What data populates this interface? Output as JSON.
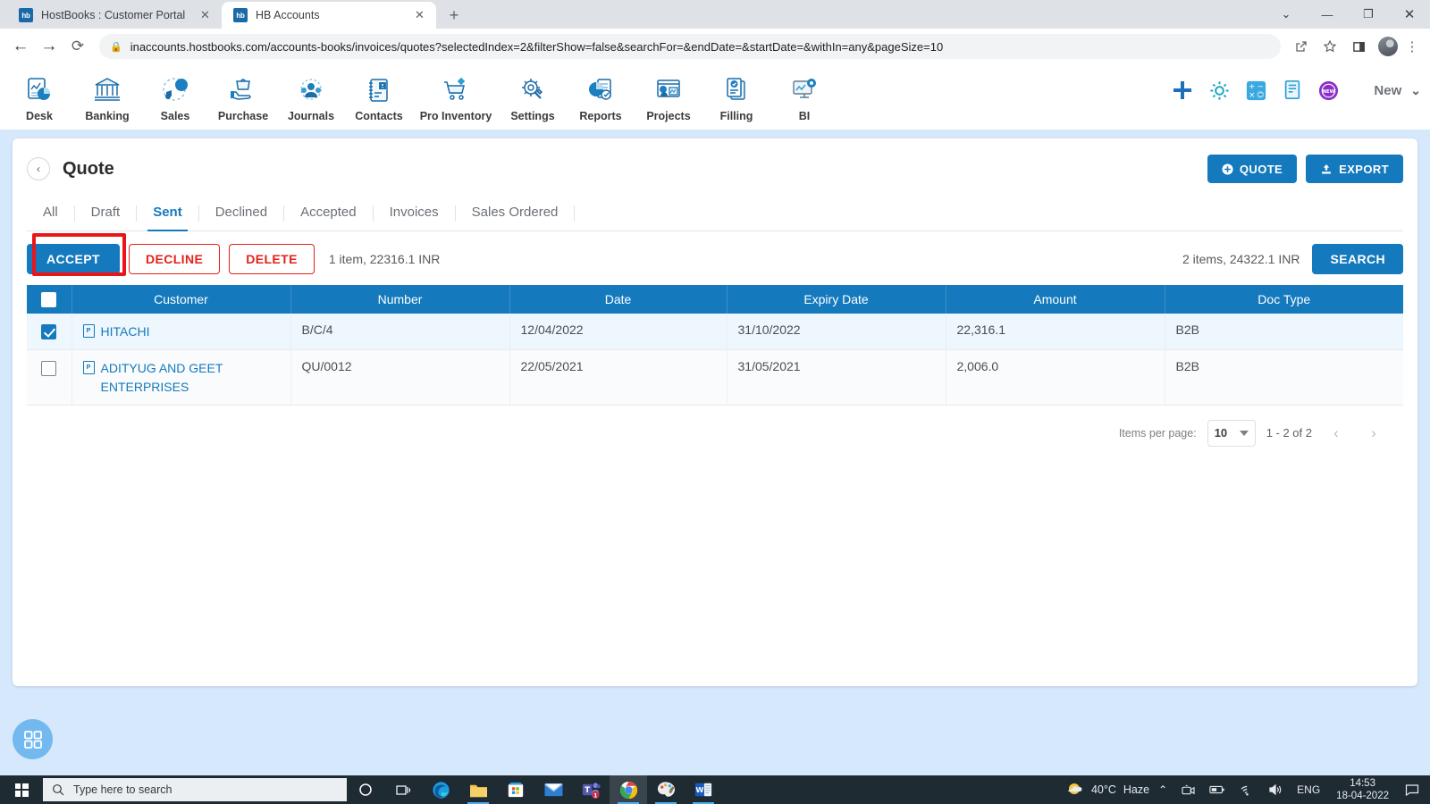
{
  "browser": {
    "tabs": [
      {
        "title": "HostBooks : Customer Portal",
        "favicon_label": "hb",
        "active": false
      },
      {
        "title": "HB Accounts",
        "favicon_label": "hb",
        "active": true
      }
    ],
    "new_tab_label": "+",
    "window_controls": {
      "minimize": "—",
      "maximize": "❐",
      "close": "✕",
      "expand": "⌄"
    },
    "nav": {
      "back": "←",
      "forward": "→",
      "reload": "⟳"
    },
    "url": {
      "lock_icon": "lock-icon",
      "host": "inaccounts.hostbooks.com",
      "path": "/accounts-books/invoices/quotes?selectedIndex=2&filterShow=false&searchFor=&endDate=&startDate=&withIn=any&pageSize=10",
      "full": "inaccounts.hostbooks.com/accounts-books/invoices/quotes?selectedIndex=2&filterShow=false&searchFor=&endDate=&startDate=&withIn=any&pageSize=10"
    },
    "toolbar_icons": [
      "share-icon",
      "bookmark-star-icon",
      "sidepanel-icon",
      "profile-avatar",
      "kebab-menu-icon"
    ]
  },
  "appnav": {
    "items": [
      {
        "label": "Desk",
        "icon": "desk-analytics-icon"
      },
      {
        "label": "Banking",
        "icon": "bank-building-icon"
      },
      {
        "label": "Sales",
        "icon": "sales-megaphone-icon"
      },
      {
        "label": "Purchase",
        "icon": "purchase-hand-bag-icon"
      },
      {
        "label": "Journals",
        "icon": "journals-people-gear-icon"
      },
      {
        "label": "Contacts",
        "icon": "contacts-notebook-icon"
      },
      {
        "label": "Pro Inventory",
        "icon": "inventory-cart-icon"
      },
      {
        "label": "Settings",
        "icon": "settings-tools-icon"
      },
      {
        "label": "Reports",
        "icon": "reports-piechart-icon"
      },
      {
        "label": "Projects",
        "icon": "projects-window-icon"
      },
      {
        "label": "Filling",
        "icon": "filing-documents-icon"
      },
      {
        "label": "BI",
        "icon": "bi-monitor-icon"
      }
    ],
    "right_icons": [
      {
        "name": "plus-add-icon",
        "color": "#1d6fb8"
      },
      {
        "name": "gear-settings-icon",
        "color": "#17a3c7"
      },
      {
        "name": "calculator-icon",
        "color": "#3aa9e0"
      },
      {
        "name": "document-note-icon",
        "color": "#2b9fd4"
      },
      {
        "name": "new-badge-icon",
        "color": "#8b2fc9",
        "text": "NEW"
      }
    ],
    "account_selector": {
      "label": "New",
      "caret": "⌄"
    }
  },
  "page": {
    "back_arrow": "‹",
    "title": "Quote",
    "header_buttons": [
      {
        "label": "QUOTE",
        "icon": "plus-circle-icon"
      },
      {
        "label": "EXPORT",
        "icon": "upload-icon"
      }
    ],
    "filter_tabs": [
      {
        "label": "All",
        "active": false
      },
      {
        "label": "Draft",
        "active": false
      },
      {
        "label": "Sent",
        "active": true
      },
      {
        "label": "Declined",
        "active": false
      },
      {
        "label": "Accepted",
        "active": false
      },
      {
        "label": "Invoices",
        "active": false
      },
      {
        "label": "Sales Ordered",
        "active": false
      }
    ],
    "actions": {
      "accept_label": "ACCEPT",
      "decline_label": "DECLINE",
      "delete_label": "DELETE",
      "selection_summary": "1 item, 22316.1 INR",
      "total_summary": "2 items, 24322.1 INR",
      "search_label": "SEARCH",
      "highlight_color": "#e8161b"
    },
    "table": {
      "columns": [
        "",
        "Customer",
        "Number",
        "Date",
        "Expiry Date",
        "Amount",
        "Doc Type"
      ],
      "header_checkbox_checked": false,
      "rows": [
        {
          "checked": true,
          "customer": "HITACHI",
          "number": "B/C/4",
          "date": "12/04/2022",
          "expiry_date": "31/10/2022",
          "amount": "22,316.1",
          "doc_type": "B2B"
        },
        {
          "checked": false,
          "customer": "ADITYUG AND GEET ENTERPRISES",
          "number": "QU/0012",
          "date": "22/05/2021",
          "expiry_date": "31/05/2021",
          "amount": "2,006.0",
          "doc_type": "B2B"
        }
      ]
    },
    "paginator": {
      "items_per_page_label": "Items per page:",
      "items_per_page_value": "10",
      "range_label": "1 - 2 of 2",
      "prev_arrow": "‹",
      "next_arrow": "›"
    },
    "fab": {
      "icon": "grid-apps-icon"
    }
  },
  "taskbar": {
    "start_icon": "windows-start-icon",
    "search_placeholder": "Type here to search",
    "search_icon": "search-icon",
    "pinned": [
      {
        "name": "cortana-icon"
      },
      {
        "name": "task-view-icon"
      },
      {
        "name": "edge-icon"
      },
      {
        "name": "file-explorer-icon"
      },
      {
        "name": "microsoft-store-icon"
      },
      {
        "name": "mail-icon"
      },
      {
        "name": "teams-icon",
        "badge": "1"
      },
      {
        "name": "chrome-icon",
        "active": true
      },
      {
        "name": "paint-3d-icon"
      },
      {
        "name": "word-icon"
      }
    ],
    "tray": {
      "weather_temp": "40°C",
      "weather_desc": "Haze",
      "weather_icon": "sun-cloud-icon",
      "chevron": "⌃",
      "icons": [
        "camera-icon",
        "battery-icon",
        "wifi-icon",
        "volume-icon"
      ],
      "language": "ENG",
      "time": "14:53",
      "date": "18-04-2022",
      "action_center": "notification-icon"
    }
  }
}
